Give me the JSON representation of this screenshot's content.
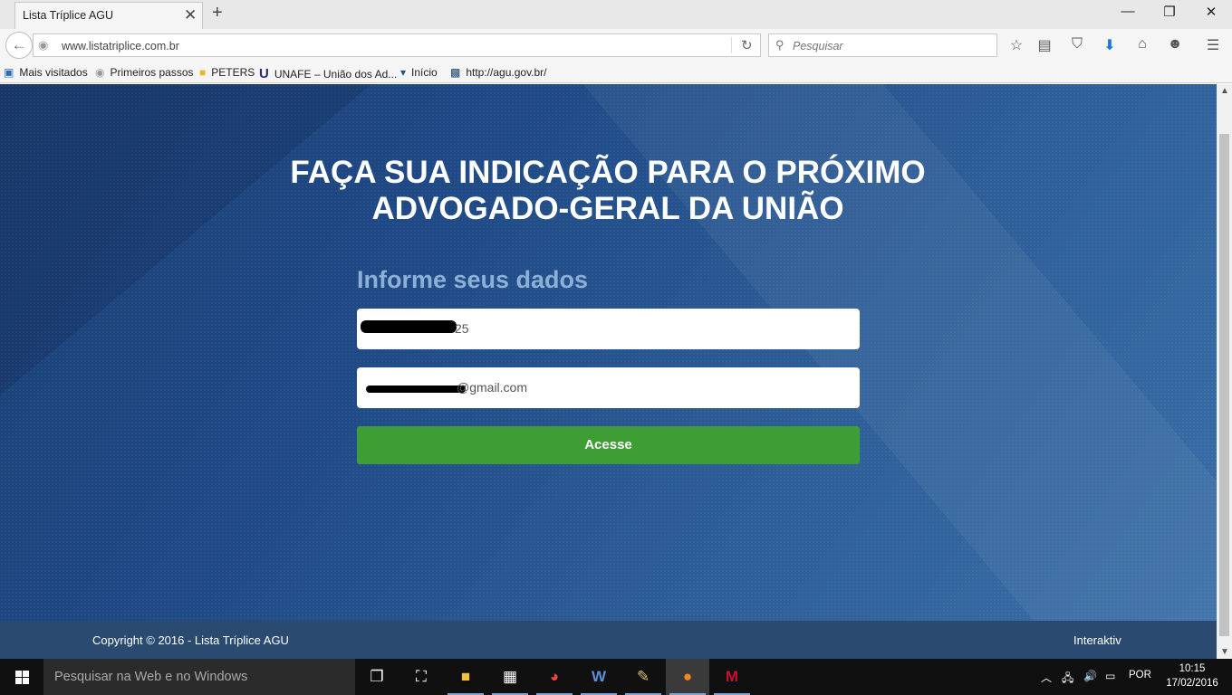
{
  "browser": {
    "tab_title": "Lista Tríplice AGU",
    "url": "www.listatriplice.com.br",
    "search_placeholder": "Pesquisar",
    "bookmarks": [
      {
        "label": "Mais visitados"
      },
      {
        "label": "Primeiros passos"
      },
      {
        "label": "PETERS"
      },
      {
        "label": "UNAFE – União dos Ad..."
      },
      {
        "label": "Início"
      },
      {
        "label": "http://agu.gov.br/"
      }
    ]
  },
  "page": {
    "headline_line1": "FAÇA SUA INDICAÇÃO PARA O PRÓXIMO",
    "headline_line2": "ADVOGADO-GERAL DA UNIÃO",
    "form_title": "Informe seus dados",
    "field1_visible": "25",
    "field2_visible": "@gmail.com",
    "submit_label": "Acesse",
    "copyright": "Copyright © 2016 - Lista Tríplice AGU",
    "credit": "Interaktiv"
  },
  "taskbar": {
    "search_placeholder": "Pesquisar na Web e no Windows",
    "language": "POR",
    "time": "10:15",
    "date": "17/02/2016"
  },
  "colors": {
    "hero": "#1f4a86",
    "button": "#3e9e35",
    "footer": "#2b4a70",
    "form_title": "#8fb0d6"
  }
}
